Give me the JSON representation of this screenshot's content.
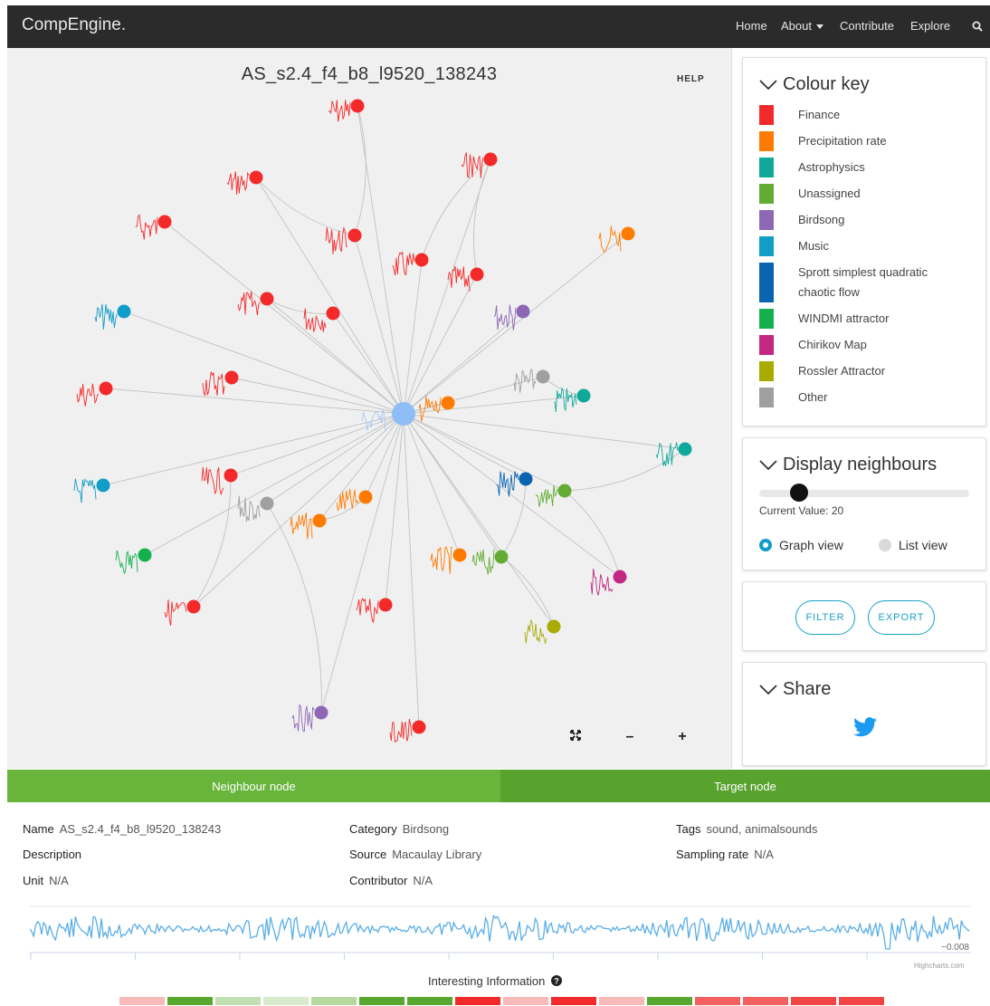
{
  "navbar": {
    "brand": "CompEngine.",
    "links": [
      "Home",
      "About",
      "Contribute",
      "Explore"
    ]
  },
  "graph": {
    "title": "AS_s2.4_f4_b8_l9520_138243",
    "help": "HELP",
    "zoom_fit": "⤧",
    "zoom_out": "–",
    "zoom_in": "+"
  },
  "colour_key": {
    "title": "Colour key",
    "items": [
      {
        "label": "Finance",
        "color": "#f42a2a"
      },
      {
        "label": "Precipitation rate",
        "color": "#ff7b00"
      },
      {
        "label": "Astrophysics",
        "color": "#10a89b"
      },
      {
        "label": "Unassigned",
        "color": "#63ac33"
      },
      {
        "label": "Birdsong",
        "color": "#8f68b5"
      },
      {
        "label": "Music",
        "color": "#129dc8"
      },
      {
        "label": "Sprott simplest quadratic chaotic flow",
        "color": "#0a64b0"
      },
      {
        "label": "WINDMI attractor",
        "color": "#15b04e"
      },
      {
        "label": "Chirikov Map",
        "color": "#c22882"
      },
      {
        "label": "Rossler Attractor",
        "color": "#a8ab00"
      },
      {
        "label": "Other",
        "color": "#a0a0a0"
      }
    ]
  },
  "neighbours": {
    "title": "Display neighbours",
    "current_value_text": "Current Value: 20",
    "graph_view": "Graph view",
    "list_view": "List view"
  },
  "actions": {
    "filter": "FILTER",
    "export": "EXPORT"
  },
  "share": {
    "title": "Share"
  },
  "tabs": {
    "neighbour": "Neighbour node",
    "target": "Target node"
  },
  "info": {
    "name_label": "Name",
    "name_value": "AS_s2.4_f4_b8_l9520_138243",
    "category_label": "Category",
    "category_value": "Birdsong",
    "tags_label": "Tags",
    "tags_value": "sound, animalsounds",
    "description_label": "Description",
    "source_label": "Source",
    "source_value": "Macaulay Library",
    "sampling_label": "Sampling rate",
    "sampling_value": "N/A",
    "unit_label": "Unit",
    "unit_value": "N/A",
    "contributor_label": "Contributor",
    "contributor_value": "N/A"
  },
  "timeseries": {
    "y_label": "−0.008",
    "credit": "Highcharts.com"
  },
  "interesting": {
    "title": "Interesting Information",
    "strip_colors": [
      "#f8b9b9",
      "#56a82e",
      "#c2dfb2",
      "#d7ebcc",
      "#b5d99f",
      "#56a82e",
      "#56a82e",
      "#f42a2a",
      "#f8b9b9",
      "#f42a2a",
      "#f8b9b9",
      "#56a82e",
      "#f26060",
      "#f26060",
      "#f24545",
      "#f24545"
    ]
  },
  "icons": {
    "search": "search-icon",
    "chevron": "chevron-down-icon",
    "twitter": "twitter-icon",
    "fit": "fit-screen-icon",
    "minus": "zoom-out-icon",
    "plus": "zoom-in-icon",
    "question": "question-circle-icon",
    "caret": "caret-down-icon"
  }
}
